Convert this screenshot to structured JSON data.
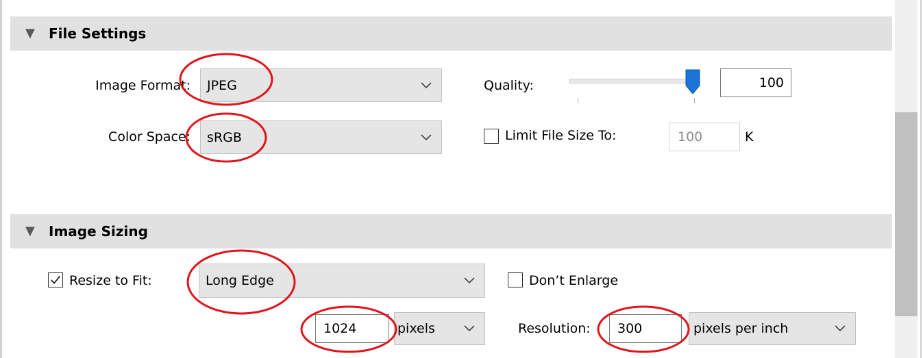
{
  "file_settings": {
    "title": "File Settings",
    "image_format_label": "Image Format:",
    "image_format_value": "JPEG",
    "color_space_label": "Color Space:",
    "color_space_value": "sRGB",
    "quality_label": "Quality:",
    "quality_value": "100",
    "quality_slider_percent": 100,
    "limit_file_size_label": "Limit File Size To:",
    "limit_file_size_checked": false,
    "limit_file_size_value": "100",
    "limit_file_size_unit": "K"
  },
  "image_sizing": {
    "title": "Image Sizing",
    "resize_to_fit_label": "Resize to Fit:",
    "resize_to_fit_checked": true,
    "resize_mode_value": "Long Edge",
    "dont_enlarge_label": "Don’t Enlarge",
    "dont_enlarge_checked": false,
    "size_value": "1024",
    "size_unit_value": "pixels",
    "resolution_label": "Resolution:",
    "resolution_value": "300",
    "resolution_unit_value": "pixels per inch"
  },
  "colors": {
    "header_bg": "#e1e1e1",
    "annotation": "#e0141b",
    "slider_thumb": "#1a73d6"
  },
  "icons": {
    "collapse": "triangle-down-icon",
    "dropdown": "chevron-down-icon",
    "check": "checkmark-icon"
  }
}
